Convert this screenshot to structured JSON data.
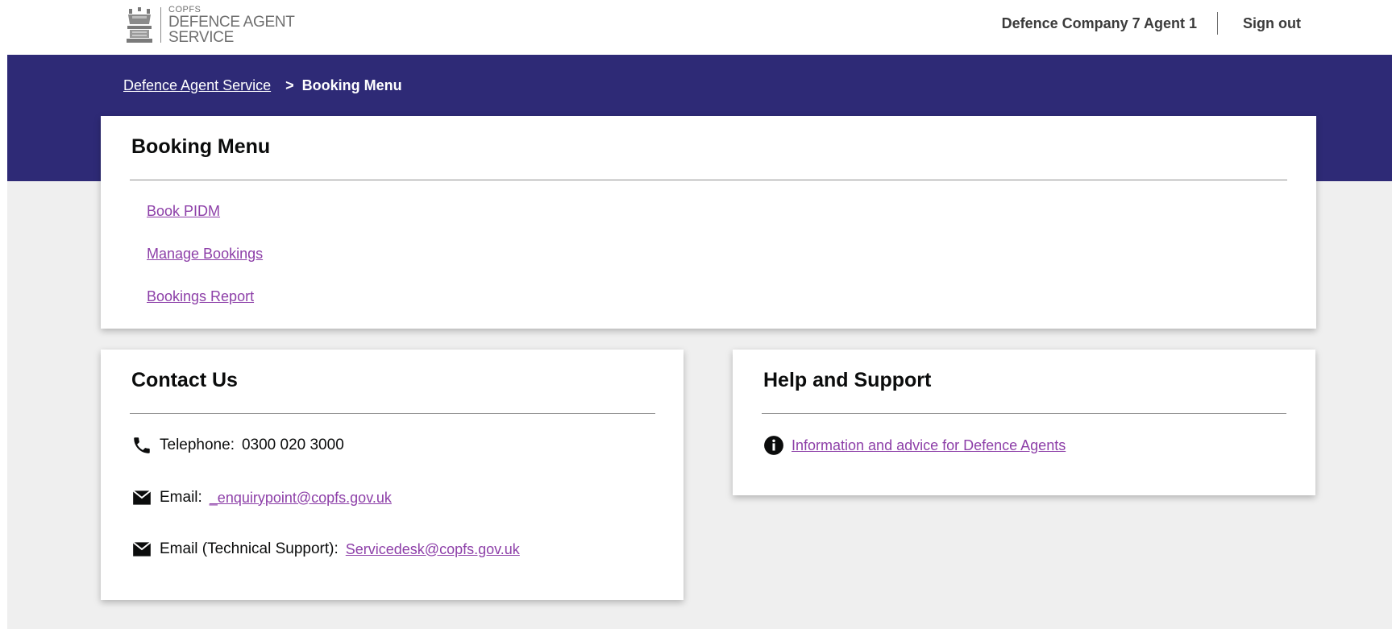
{
  "header": {
    "logo": {
      "line1": "COPFS",
      "line2": "DEFENCE AGENT",
      "line3": "SERVICE"
    },
    "user_name": "Defence Company 7 Agent 1",
    "sign_out": "Sign out"
  },
  "breadcrumb": {
    "root": "Defence Agent Service",
    "separator": ">",
    "current": "Booking Menu"
  },
  "booking_menu": {
    "title": "Booking Menu",
    "links": [
      "Book PIDM",
      "Manage Bookings",
      "Bookings Report"
    ]
  },
  "contact": {
    "title": "Contact Us",
    "telephone_label": "Telephone:",
    "telephone_value": "0300 020 3000",
    "email_label": "Email:",
    "email_value": "_enquirypoint@copfs.gov.uk",
    "tech_email_label": "Email (Technical Support):",
    "tech_email_value": "Servicedesk@copfs.gov.uk"
  },
  "help": {
    "title": "Help and Support",
    "link": "Information and advice for Defence Agents"
  },
  "colors": {
    "brand_band": "#2e2a76",
    "link": "#8d3fa8",
    "page_background": "#efefef"
  },
  "icons": {
    "logo": "crest-icon",
    "telephone": "phone-icon",
    "email": "envelope-icon",
    "info": "info-icon"
  }
}
